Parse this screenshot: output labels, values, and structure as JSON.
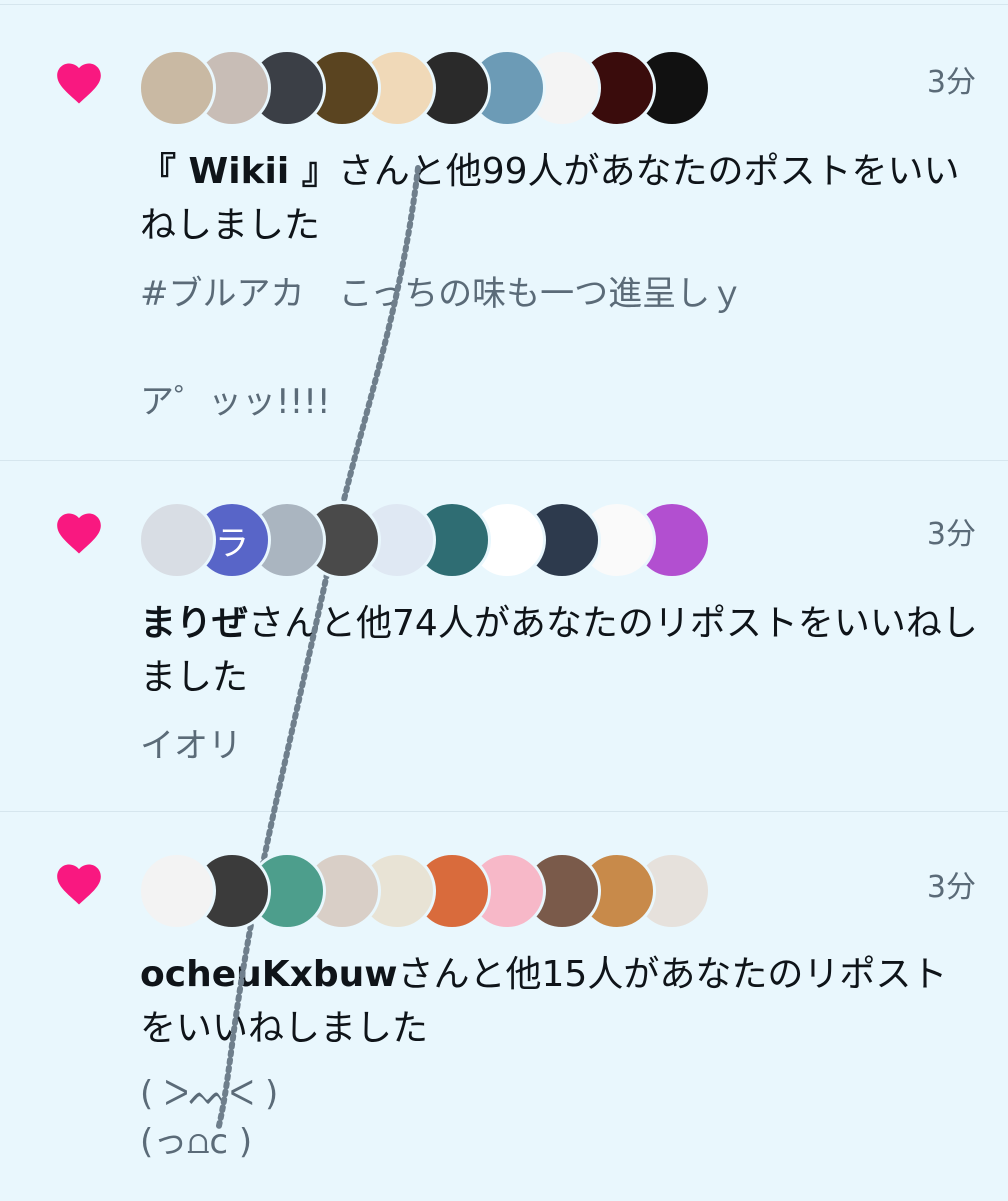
{
  "colors": {
    "heart": "#f91880",
    "background": "#e9f7fd",
    "text": "#0f1419",
    "muted": "#5b6b78"
  },
  "notifications": [
    {
      "icon": "heart-icon",
      "time": "3分",
      "user": "『 Wikii 』",
      "summary_rest": "さんと他99人があなたのポストをいいねしました",
      "snippet": "#ブルアカ　こっちの味も一つ進呈しｙ\n\nア゜ッッ!!!!",
      "avatars": [
        {
          "bg": "#c9b9a3",
          "label": ""
        },
        {
          "bg": "#c8bdb6",
          "label": ""
        },
        {
          "bg": "#3b3f46",
          "label": ""
        },
        {
          "bg": "#5a4420",
          "label": ""
        },
        {
          "bg": "#f0d9b8",
          "label": ""
        },
        {
          "bg": "#2a2a2a",
          "label": ""
        },
        {
          "bg": "#6c9bb6",
          "label": ""
        },
        {
          "bg": "#f4f4f4",
          "label": ""
        },
        {
          "bg": "#3a0c0c",
          "label": ""
        },
        {
          "bg": "#111111",
          "label": ""
        }
      ]
    },
    {
      "icon": "heart-icon",
      "time": "3分",
      "user": "まりぜ",
      "summary_rest": "さんと他74人があなたのリポストをいいねしました",
      "snippet": "イオリ",
      "avatars": [
        {
          "bg": "#d8dde4",
          "label": ""
        },
        {
          "bg": "#5865c8",
          "label": "ラ"
        },
        {
          "bg": "#aab5c0",
          "label": ""
        },
        {
          "bg": "#4a4a4a",
          "label": ""
        },
        {
          "bg": "#dfe8f3",
          "label": ""
        },
        {
          "bg": "#2f6d73",
          "label": ""
        },
        {
          "bg": "#ffffff",
          "label": ""
        },
        {
          "bg": "#2d3a4d",
          "label": ""
        },
        {
          "bg": "#fafafa",
          "label": ""
        },
        {
          "bg": "#b24fd0",
          "label": ""
        }
      ]
    },
    {
      "icon": "heart-icon",
      "time": "3分",
      "user": "ocheuKxbuw",
      "summary_rest": "さんと他15人があなたのリポストをいいねしました",
      "snippet": "( ᐳᨓᐸ )\n(っ⩍c )",
      "avatars": [
        {
          "bg": "#f3f3f3",
          "label": ""
        },
        {
          "bg": "#3b3b3b",
          "label": ""
        },
        {
          "bg": "#4d9e8c",
          "label": ""
        },
        {
          "bg": "#d9cfc7",
          "label": ""
        },
        {
          "bg": "#e8e3d5",
          "label": ""
        },
        {
          "bg": "#d96b3c",
          "label": ""
        },
        {
          "bg": "#f7b8c8",
          "label": ""
        },
        {
          "bg": "#7a5a4a",
          "label": ""
        },
        {
          "bg": "#c88a4a",
          "label": ""
        },
        {
          "bg": "#e6e1dc",
          "label": ""
        }
      ]
    }
  ]
}
